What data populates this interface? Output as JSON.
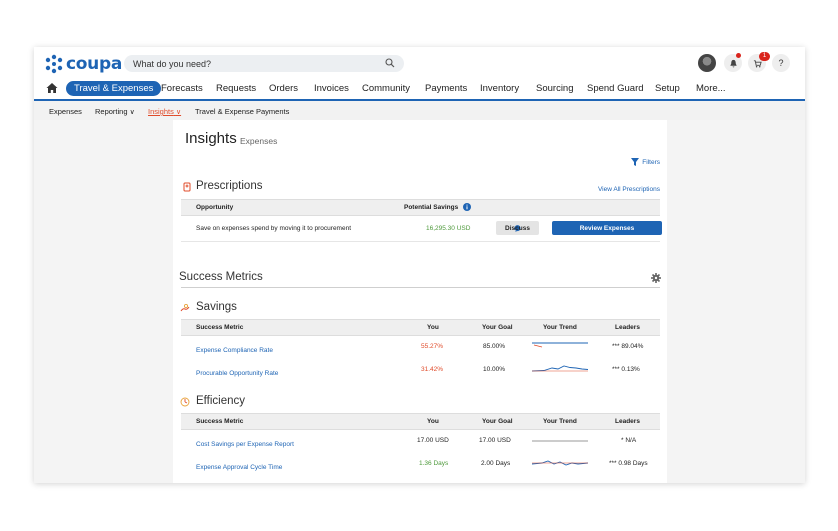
{
  "logo": "coupa",
  "search": {
    "placeholder": "What do you need?"
  },
  "top_right": {
    "cart_badge": "1",
    "help_label": "?"
  },
  "nav": {
    "active": "Travel & Expenses",
    "items": [
      "Forecasts",
      "Requests",
      "Orders",
      "Invoices",
      "Community",
      "Payments",
      "Inventory",
      "Sourcing",
      "Spend Guard",
      "Setup",
      "More..."
    ]
  },
  "subnav": {
    "items": [
      {
        "label": "Expenses",
        "chevron": false,
        "active": false
      },
      {
        "label": "Reporting",
        "chevron": true,
        "active": false
      },
      {
        "label": "Insights",
        "chevron": true,
        "active": true
      },
      {
        "label": "Travel & Expense Payments",
        "chevron": false,
        "active": false
      }
    ]
  },
  "page": {
    "title": "Insights",
    "subtitle": "Expenses",
    "filters_label": "Filters"
  },
  "prescriptions": {
    "title": "Prescriptions",
    "view_all": "View All Prescriptions",
    "headers": {
      "opportunity": "Opportunity",
      "savings": "Potential Savings"
    },
    "row": {
      "opportunity": "Save on expenses spend by moving it to procurement",
      "savings": "16,295.30 USD",
      "discuss_label": "Discuss",
      "review_label": "Review Expenses"
    }
  },
  "success_metrics": {
    "title": "Success Metrics"
  },
  "savings": {
    "title": "Savings",
    "headers": [
      "Success Metric",
      "You",
      "Your Goal",
      "Your Trend",
      "Leaders"
    ],
    "rows": [
      {
        "metric": "Expense Compliance Rate",
        "you": "55.27%",
        "goal": "85.00%",
        "leaders": "*** 89.04%",
        "you_color": "red"
      },
      {
        "metric": "Procurable Opportunity Rate",
        "you": "31.42%",
        "goal": "10.00%",
        "leaders": "*** 0.13%",
        "you_color": "red"
      }
    ]
  },
  "efficiency": {
    "title": "Efficiency",
    "headers": [
      "Success Metric",
      "You",
      "Your Goal",
      "Your Trend",
      "Leaders"
    ],
    "rows": [
      {
        "metric": "Cost Savings per Expense Report",
        "you": "17.00 USD",
        "goal": "17.00 USD",
        "leaders": "* N/A",
        "you_color": "normal"
      },
      {
        "metric": "Expense Approval Cycle Time",
        "you": "1.36 Days",
        "goal": "2.00 Days",
        "leaders": "*** 0.98 Days",
        "you_color": "green"
      }
    ]
  },
  "colors": {
    "brand": "#1e64b4",
    "alert": "#e04b2a",
    "good": "#4f9a3c",
    "badge": "#d9241c"
  }
}
